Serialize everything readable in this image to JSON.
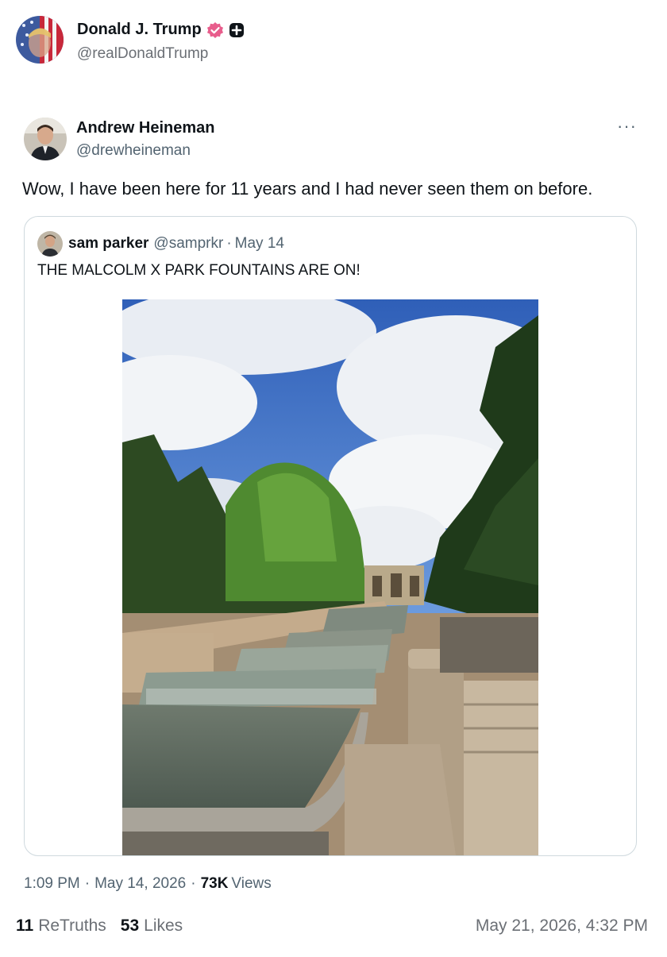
{
  "outer_post": {
    "display_name": "Donald J. Trump",
    "handle": "@realDonaldTrump",
    "icons": [
      "verified-badge-icon",
      "plus-badge-icon"
    ]
  },
  "tweet": {
    "display_name": "Andrew Heineman",
    "handle": "@drewheineman",
    "more_label": "···",
    "text": "Wow, I have been here for 11 years and I had never seen them on before.",
    "quoted": {
      "display_name": "sam parker",
      "handle": "@samprkr",
      "separator": "·",
      "date": "May 14",
      "text": "THE MALCOLM X PARK FOUNTAINS ARE ON!"
    },
    "time": "1:09 PM",
    "date": "May 14, 2026",
    "separator": "·",
    "views_count": "73K",
    "views_label": "Views"
  },
  "footer": {
    "retruths_count": "11",
    "retruths_label": "ReTruths",
    "likes_count": "53",
    "likes_label": "Likes",
    "post_date": "May 21, 2026, 4:32 PM"
  },
  "colors": {
    "verified": "#e85d8c",
    "secondary_text": "#536471",
    "border": "#cfd9de",
    "primary_text": "#0f1419"
  }
}
